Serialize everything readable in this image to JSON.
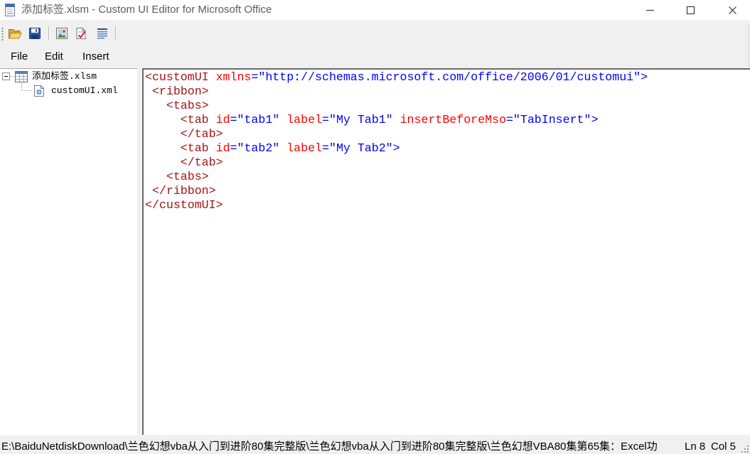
{
  "window": {
    "title": "添加标签.xlsm - Custom UI Editor for Microsoft Office",
    "app_icon": "workbook-document-icon",
    "control_icons": [
      "minimize-icon",
      "maximize-icon",
      "close-icon"
    ]
  },
  "toolbar": {
    "icons": [
      "open-folder-icon",
      "save-icon",
      "insert-picture-icon",
      "validate-icon",
      "generate-callbacks-icon"
    ]
  },
  "menu": {
    "file": "File",
    "edit": "Edit",
    "insert": "Insert"
  },
  "tree": {
    "root": {
      "label": "添加标签.xlsm",
      "icon": "excel-workbook-icon",
      "expanded": true
    },
    "children": [
      {
        "label": "customUI.xml",
        "icon": "xml-file-icon"
      }
    ]
  },
  "editor": {
    "syntax_colors": {
      "tag": "#a31515",
      "attribute": "#ff0000",
      "operator": "#0000ff",
      "value": "#0000ff",
      "space": "#000000"
    },
    "lines": [
      [
        {
          "tag": "<customUI"
        },
        {
          "space": " "
        },
        {
          "attribute": "xmlns"
        },
        {
          "operator": "="
        },
        {
          "value": "\"http://schemas.microsoft.com/office/2006/01/customui\""
        },
        {
          "operator": ">"
        }
      ],
      [
        {
          "space": " "
        },
        {
          "tag": "<ribbon>"
        }
      ],
      [
        {
          "space": "   "
        },
        {
          "tag": "<tabs>"
        }
      ],
      [
        {
          "space": "     "
        },
        {
          "tag": "<tab"
        },
        {
          "space": " "
        },
        {
          "attribute": "id"
        },
        {
          "operator": "="
        },
        {
          "value": "\"tab1\""
        },
        {
          "space": " "
        },
        {
          "attribute": "label"
        },
        {
          "operator": "="
        },
        {
          "value": "\"My Tab1\""
        },
        {
          "space": " "
        },
        {
          "attribute": "insertBeforeMso"
        },
        {
          "operator": "="
        },
        {
          "value": "\"TabInsert\""
        },
        {
          "operator": ">"
        }
      ],
      [
        {
          "space": "     "
        },
        {
          "tag": "</tab>"
        }
      ],
      [
        {
          "space": "     "
        },
        {
          "tag": "<tab"
        },
        {
          "space": " "
        },
        {
          "attribute": "id"
        },
        {
          "operator": "="
        },
        {
          "value": "\"tab2\""
        },
        {
          "space": " "
        },
        {
          "attribute": "label"
        },
        {
          "operator": "="
        },
        {
          "value": "\"My Tab2\""
        },
        {
          "operator": ">"
        }
      ],
      [
        {
          "space": "     "
        },
        {
          "tag": "</tab>"
        }
      ],
      [
        {
          "space": "   "
        },
        {
          "tag": "<tabs>"
        }
      ],
      [
        {
          "space": " "
        },
        {
          "tag": "</ribbon>"
        }
      ],
      [
        {
          "tag": "</customUI>"
        }
      ]
    ]
  },
  "status_bar": {
    "path": "E:\\BaiduNetdiskDownload\\兰色幻想vba从入门到进阶80集完整版\\兰色幻想vba从入门到进阶80集完整版\\兰色幻想VBA80集第65集：Excel功",
    "line": "Ln 8",
    "column": "Col 5"
  }
}
